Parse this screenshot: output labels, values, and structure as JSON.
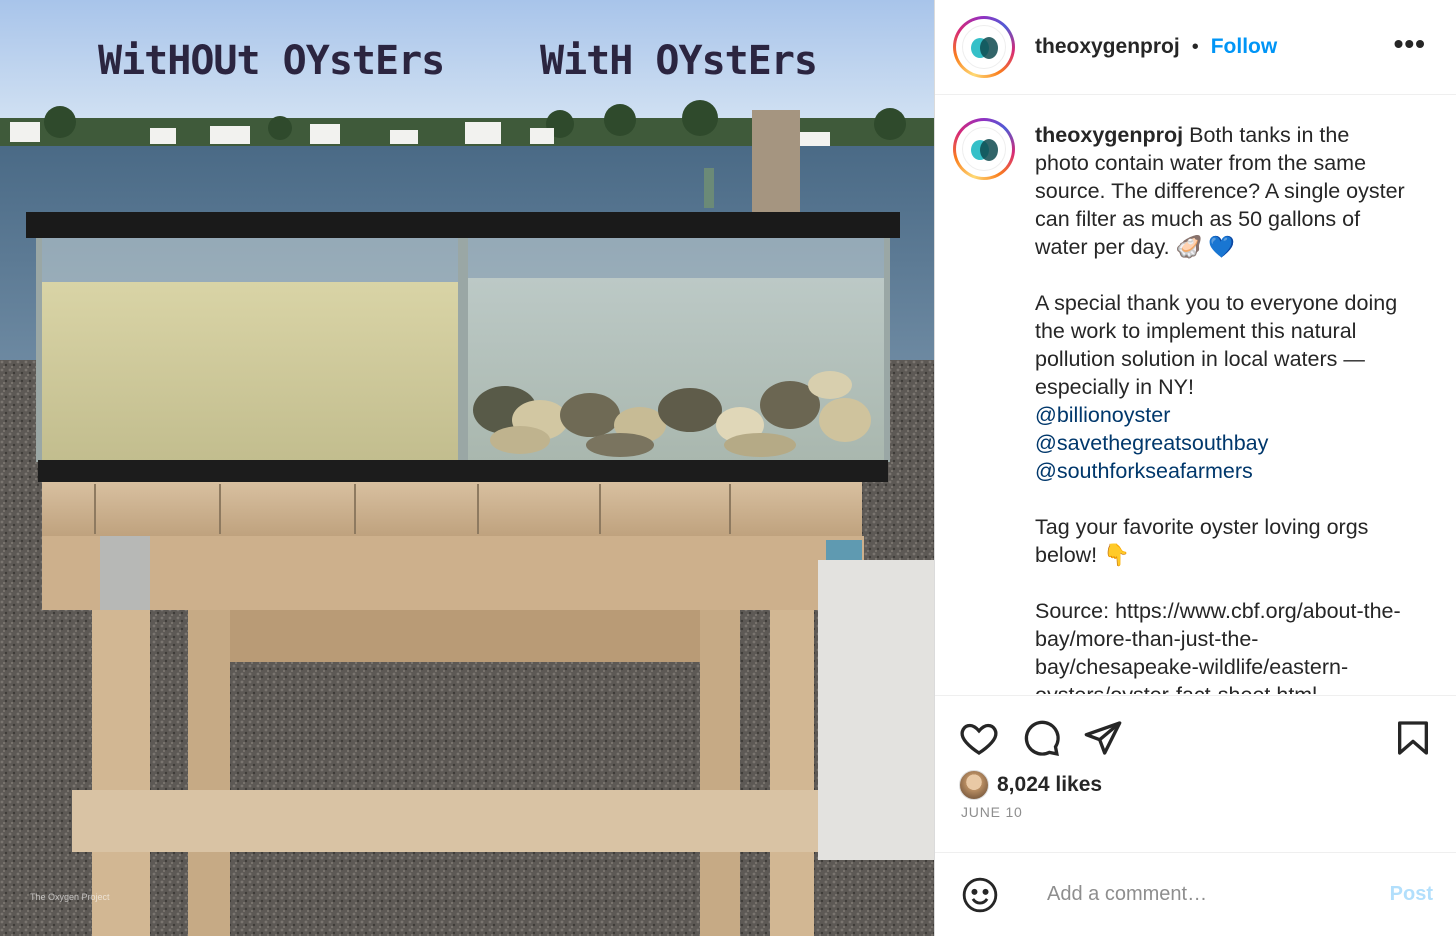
{
  "photo": {
    "left_label": "WitHOUt OYstErs",
    "right_label": "WitH OYstErs",
    "watermark": "The Oxygen Project"
  },
  "header": {
    "username": "theoxygenproj",
    "separator": "•",
    "follow_label": "Follow",
    "more_label": "•••"
  },
  "caption": {
    "username": "theoxygenproj",
    "text_1": " Both tanks in the photo contain water from the same source. The difference? A single oyster can filter as much as 50 gallons of water per day. 🦪 💙\n\nA special thank you to everyone doing the work to implement this natural pollution solution in local waters — especially in NY!",
    "mentions": [
      "@billionoyster",
      "@savethegreatsouthbay",
      "@southforkseafarmers"
    ],
    "text_2": "\nTag your favorite oyster loving orgs below! 👇\n\nSource: https://www.cbf.org/about-the-bay/more-than-just-the-bay/chesapeake-wildlife/eastern-oysters/oyster-fact-sheet.html"
  },
  "actions": {
    "icons": [
      "heart-icon",
      "comment-icon",
      "share-icon",
      "bookmark-icon"
    ],
    "likes": "8,024 likes",
    "date": "JUNE 10"
  },
  "comment": {
    "placeholder": "Add a comment…",
    "post_label": "Post"
  },
  "colors": {
    "link": "#0095f6",
    "mention": "#00376b",
    "post_disabled": "#b2dffc"
  }
}
